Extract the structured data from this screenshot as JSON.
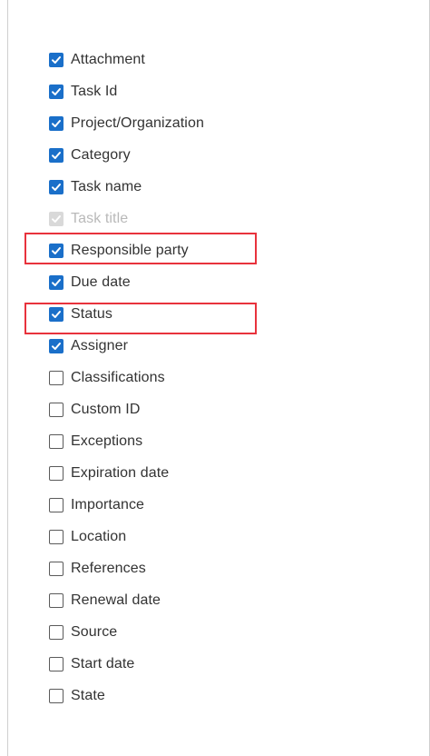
{
  "colors": {
    "accent": "#1a6fc9",
    "highlight": "#e8323c"
  },
  "columns": [
    {
      "label": "Attachment",
      "checked": true,
      "disabled": false
    },
    {
      "label": "Task Id",
      "checked": true,
      "disabled": false
    },
    {
      "label": "Project/Organization",
      "checked": true,
      "disabled": false
    },
    {
      "label": "Category",
      "checked": true,
      "disabled": false
    },
    {
      "label": "Task name",
      "checked": true,
      "disabled": false
    },
    {
      "label": "Task title",
      "checked": true,
      "disabled": true
    },
    {
      "label": "Responsible party",
      "checked": true,
      "disabled": false,
      "highlighted": true
    },
    {
      "label": "Due date",
      "checked": true,
      "disabled": false
    },
    {
      "label": "Status",
      "checked": true,
      "disabled": false
    },
    {
      "label": "Assigner",
      "checked": true,
      "disabled": false,
      "highlighted": true
    },
    {
      "label": "Classifications",
      "checked": false,
      "disabled": false
    },
    {
      "label": "Custom ID",
      "checked": false,
      "disabled": false
    },
    {
      "label": "Exceptions",
      "checked": false,
      "disabled": false
    },
    {
      "label": "Expiration date",
      "checked": false,
      "disabled": false
    },
    {
      "label": "Importance",
      "checked": false,
      "disabled": false
    },
    {
      "label": "Location",
      "checked": false,
      "disabled": false
    },
    {
      "label": "References",
      "checked": false,
      "disabled": false
    },
    {
      "label": "Renewal date",
      "checked": false,
      "disabled": false
    },
    {
      "label": "Source",
      "checked": false,
      "disabled": false
    },
    {
      "label": "Start date",
      "checked": false,
      "disabled": false
    },
    {
      "label": "State",
      "checked": false,
      "disabled": false
    }
  ]
}
